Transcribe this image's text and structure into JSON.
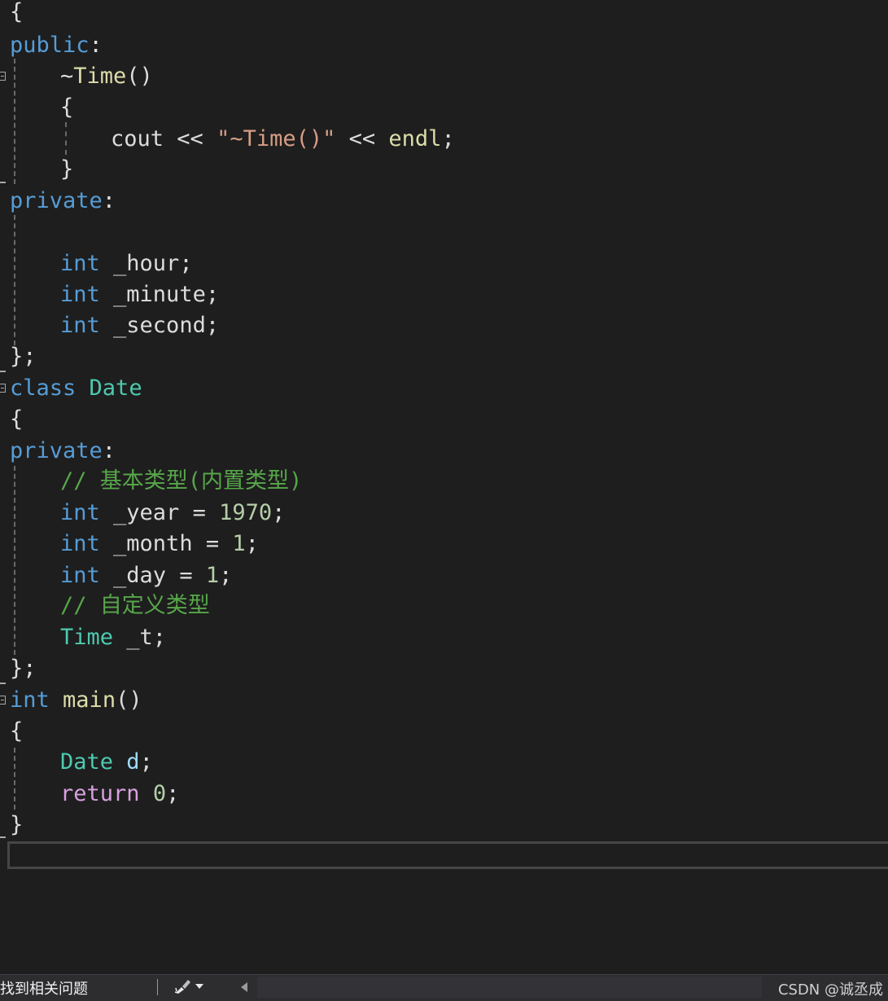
{
  "code_lines": [
    [
      "{"
    ],
    [
      "public",
      ":"
    ],
    [
      "~",
      "Time",
      "()"
    ],
    [
      "{"
    ],
    [
      "cout",
      " << ",
      "\"~Time()\"",
      " << ",
      "endl",
      ";"
    ],
    [
      "}"
    ],
    [
      "private",
      ":"
    ],
    [],
    [
      "int",
      " _hour;"
    ],
    [
      "int",
      " _minute;"
    ],
    [
      "int",
      " _second;"
    ],
    [
      "};"
    ],
    [
      "class",
      " ",
      "Date"
    ],
    [
      "{"
    ],
    [
      "private",
      ":"
    ],
    [
      "// 基本类型(内置类型)"
    ],
    [
      "int",
      " _year = ",
      "1970",
      ";"
    ],
    [
      "int",
      " _month = ",
      "1",
      ";"
    ],
    [
      "int",
      " _day = ",
      "1",
      ";"
    ],
    [
      "// 自定义类型"
    ],
    [
      "Time",
      " _t;"
    ],
    [
      "};"
    ],
    [
      "int",
      " ",
      "main",
      "()"
    ],
    [
      "{"
    ],
    [
      "Date",
      " ",
      "d",
      ";"
    ],
    [
      "return",
      " ",
      "0",
      ";"
    ],
    [
      "}"
    ]
  ],
  "status_bar": {
    "issues_text": "找到相关问题",
    "brush_icon": "brush-icon",
    "dropdown_icon": "chevron-down-icon",
    "scroll_icon": "triangle-left-icon"
  },
  "watermark": "CSDN @诚丞成",
  "colors": {
    "background": "#1e1e1e",
    "keyword": "#569cd6",
    "type": "#4ec9b0",
    "function": "#dcdcaa",
    "string": "#d69d85",
    "number": "#b5cea8",
    "comment": "#57a64a",
    "control": "#d8a0df",
    "variable": "#9cdcfe",
    "plain": "#dcdcdc"
  }
}
